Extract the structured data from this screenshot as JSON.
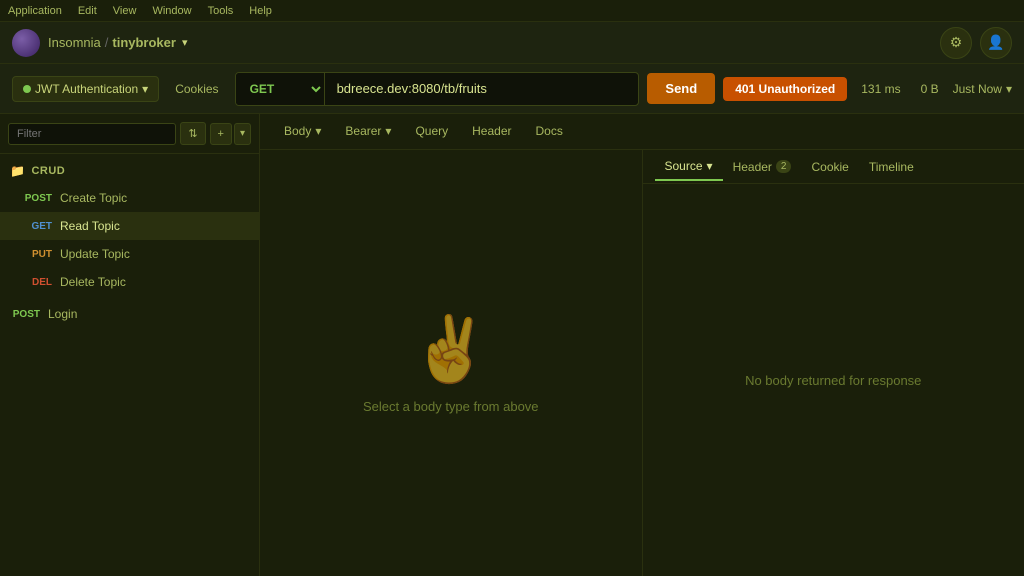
{
  "menubar": {
    "items": [
      "Application",
      "Edit",
      "View",
      "Window",
      "Tools",
      "Help"
    ]
  },
  "titlebar": {
    "app_name": "Insomnia",
    "separator": "/",
    "project": "tinybroker",
    "settings_icon": "⚙",
    "account_icon": "👤"
  },
  "request_bar": {
    "auth_label": "JWT Authentication",
    "cookies_label": "Cookies",
    "method": "GET",
    "url": "bdreece.dev:8080/tb/fruits",
    "send_label": "Send",
    "status": "401 Unauthorized",
    "time": "131 ms",
    "size": "0 B",
    "timestamp": "Just Now"
  },
  "sidebar": {
    "filter_placeholder": "Filter",
    "sort_icon": "⇅",
    "add_icon": "+",
    "add_chevron": "▾",
    "section_icon": "📁",
    "section_label": "CRUD",
    "items": [
      {
        "method": "POST",
        "method_tag": "POST",
        "label": "Create Topic",
        "type": "post",
        "active": false
      },
      {
        "method": "GET",
        "method_tag": "GET",
        "label": "Read Topic",
        "type": "get",
        "active": true
      },
      {
        "method": "PUT",
        "method_tag": "PUT",
        "label": "Update Topic",
        "type": "put",
        "active": false
      },
      {
        "method": "DELETE",
        "method_tag": "DEL",
        "label": "Delete Topic",
        "type": "del",
        "active": false
      }
    ],
    "extra_items": [
      {
        "method": "POST",
        "method_tag": "POST",
        "label": "Login",
        "type": "post",
        "active": false
      }
    ]
  },
  "request_tabs": {
    "body_label": "Body",
    "bearer_label": "Bearer",
    "query_label": "Query",
    "header_label": "Header",
    "docs_label": "Docs"
  },
  "response_tabs": {
    "source_label": "Source",
    "header_label": "Header",
    "header_badge": "2",
    "cookie_label": "Cookie",
    "timeline_label": "Timeline"
  },
  "body_panel": {
    "empty_text": "Select a body type from above",
    "hand_icon": "✌️"
  },
  "response_panel": {
    "no_body_text": "No body returned for response"
  }
}
